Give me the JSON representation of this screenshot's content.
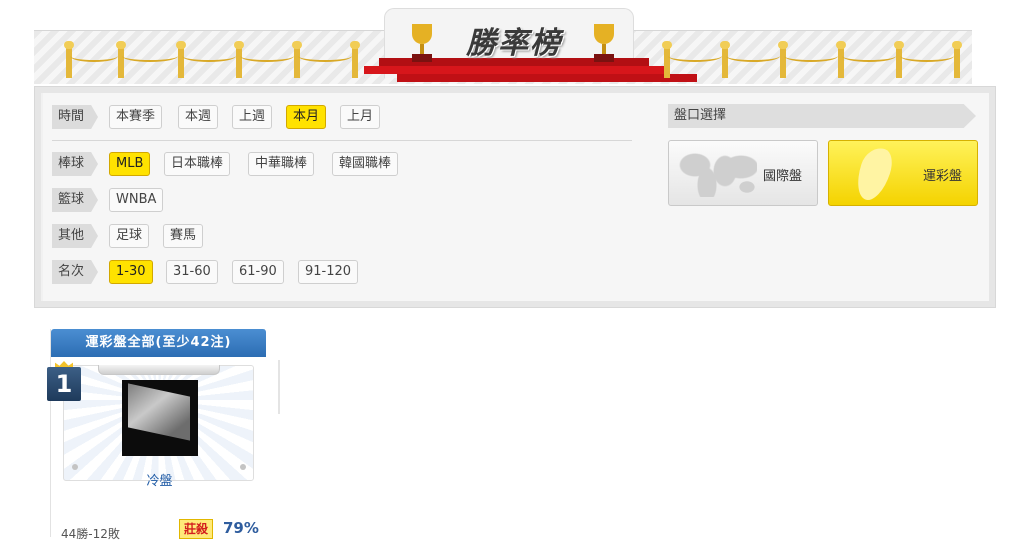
{
  "banner": {
    "title": "勝率榜"
  },
  "filters": {
    "time": {
      "label": "時間",
      "options": [
        "本賽季",
        "本週",
        "上週",
        "本月",
        "上月"
      ],
      "selected": "本月"
    },
    "baseball": {
      "label": "棒球",
      "options": [
        "MLB",
        "日本職棒",
        "中華職棒",
        "韓國職棒"
      ],
      "selected": "MLB"
    },
    "basketball": {
      "label": "籃球",
      "options": [
        "WNBA"
      ],
      "selected": ""
    },
    "other": {
      "label": "其他",
      "options": [
        "足球",
        "賽馬"
      ],
      "selected": ""
    },
    "rank": {
      "label": "名次",
      "options": [
        "1-30",
        "31-60",
        "61-90",
        "91-120"
      ],
      "selected": "1-30"
    }
  },
  "pankou": {
    "label": "盤口選擇",
    "international": "國際盤",
    "sports_lottery": "運彩盤",
    "selected": "運彩盤"
  },
  "ranking": {
    "header": "運彩盤全部(至少42注)",
    "entries": [
      {
        "rank": "1",
        "name": "冷盤",
        "record": "44勝-12敗",
        "tag": "莊殺",
        "win_rate": "79%"
      }
    ]
  }
}
